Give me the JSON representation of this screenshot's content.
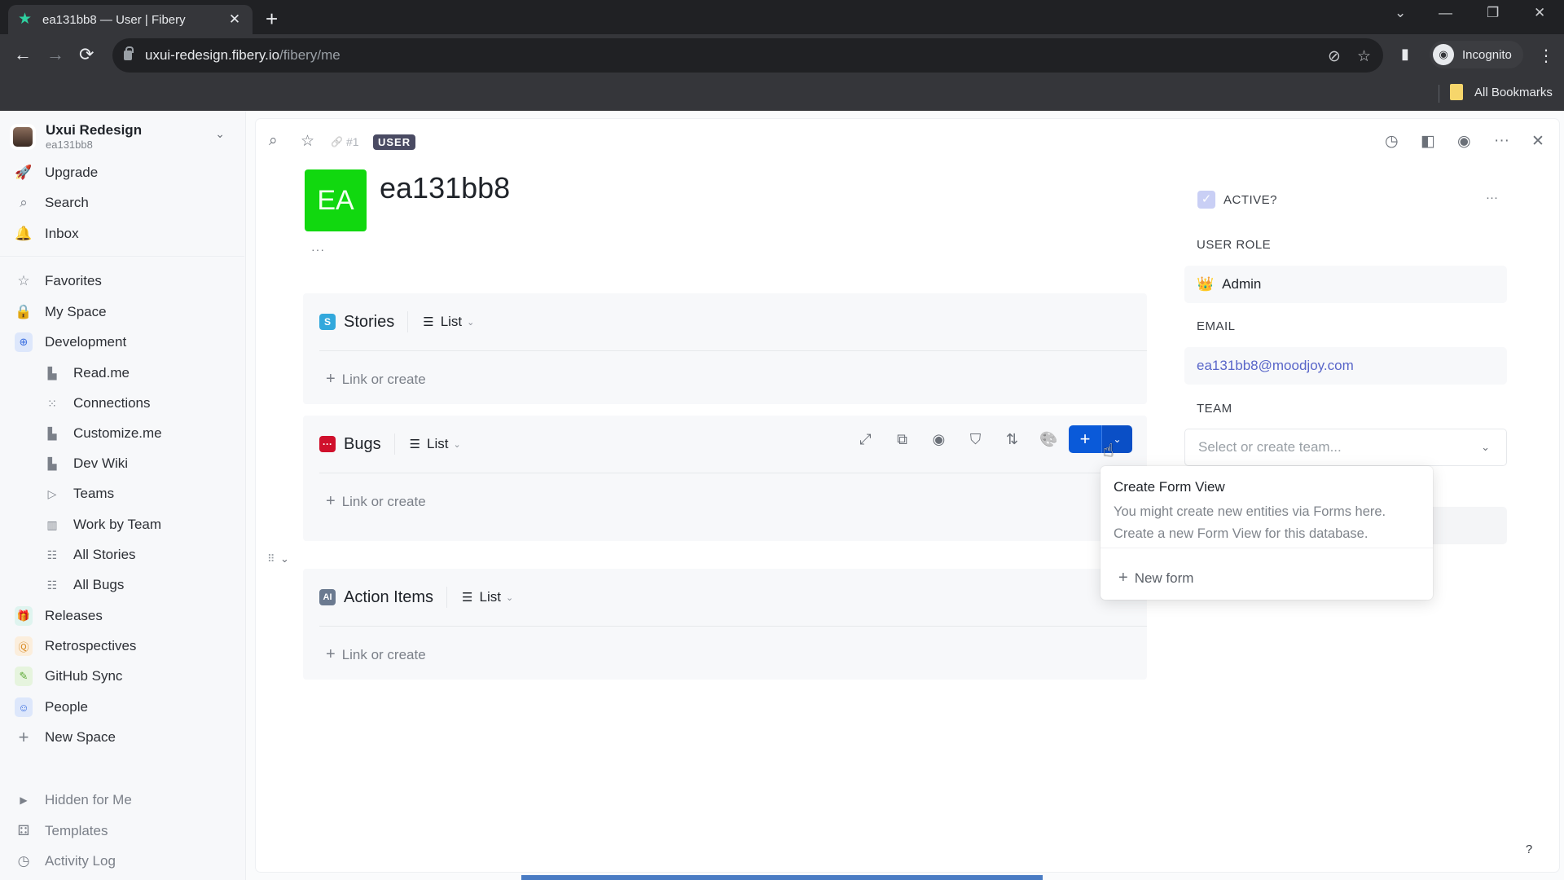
{
  "browser": {
    "tab_title": "ea131bb8 — User | Fibery",
    "url_host": "uxui-redesign.fibery.io",
    "url_path": "/fibery/me",
    "profile_label": "Incognito",
    "bookmarks_label": "All Bookmarks",
    "icons": {
      "favicon": "fibery-star-icon",
      "new_tab": "plus-icon",
      "back": "arrow-left-icon",
      "forward": "arrow-right-icon",
      "reload": "reload-icon",
      "lock": "lock-icon",
      "eye_off": "eye-off-icon",
      "bookmark": "star-icon",
      "side_panel": "side-panel-icon",
      "menu": "kebab-icon"
    },
    "glyphs": {
      "close": "✕",
      "plus": "+",
      "back": "←",
      "forward": "→",
      "reload": "⟳",
      "tab_search": "⌄",
      "minimize": "—",
      "restore": "❐",
      "win_close": "✕",
      "eye_off": "⊘",
      "star": "☆",
      "side_panel": "▮",
      "incognito": "◉",
      "kebab": "⋮"
    }
  },
  "sidebar": {
    "workspace": {
      "name": "Uxui Redesign",
      "user": "ea131bb8",
      "chevron": "⌄"
    },
    "top_items": [
      {
        "label": "Upgrade",
        "icon": "rocket-icon",
        "glyph": "🚀"
      },
      {
        "label": "Search",
        "icon": "search-icon",
        "glyph": "⌕"
      },
      {
        "label": "Inbox",
        "icon": "bell-icon",
        "glyph": "🔔"
      }
    ],
    "items": [
      {
        "label": "Favorites",
        "icon": "star-icon",
        "glyph": "☆"
      },
      {
        "label": "My Space",
        "icon": "lock-icon",
        "glyph": "🔒"
      },
      {
        "label": "Development",
        "icon": "development-space-icon",
        "glyph": "⊕",
        "color": "#3b6fe0",
        "bg": "#dde7fb"
      }
    ],
    "dev_children": [
      {
        "label": "Read.me",
        "icon": "document-icon",
        "glyph": "▙"
      },
      {
        "label": "Connections",
        "icon": "connections-icon",
        "glyph": "⁙"
      },
      {
        "label": "Customize.me",
        "icon": "document-icon",
        "glyph": "▙"
      },
      {
        "label": "Dev Wiki",
        "icon": "document-icon",
        "glyph": "▙"
      },
      {
        "label": "Teams",
        "icon": "database-icon",
        "glyph": "▷"
      },
      {
        "label": "Work by Team",
        "icon": "board-view-icon",
        "glyph": "▥"
      },
      {
        "label": "All Stories",
        "icon": "table-view-icon",
        "glyph": "☷"
      },
      {
        "label": "All Bugs",
        "icon": "table-view-icon",
        "glyph": "☷"
      }
    ],
    "spaces": [
      {
        "label": "Releases",
        "icon": "gift-icon",
        "glyph": "🎁",
        "color": "#26a08a",
        "bg": "#dff4ef"
      },
      {
        "label": "Retrospectives",
        "icon": "retro-icon",
        "glyph": "Ⓠ",
        "color": "#d98a22",
        "bg": "#fbeedd"
      },
      {
        "label": "GitHub Sync",
        "icon": "screw-icon",
        "glyph": "✎",
        "color": "#5aa832",
        "bg": "#e6f4de"
      },
      {
        "label": "People",
        "icon": "people-space-icon",
        "glyph": "☺",
        "color": "#3b6fe0",
        "bg": "#dde7fb"
      },
      {
        "label": "New Space",
        "icon": "plus-icon",
        "glyph": "+"
      }
    ],
    "bottom_items": [
      {
        "label": "Hidden for Me",
        "icon": "triangle-right-icon",
        "glyph": "▶"
      },
      {
        "label": "Templates",
        "icon": "templates-icon",
        "glyph": "⚃"
      },
      {
        "label": "Activity Log",
        "icon": "clock-icon",
        "glyph": "◷"
      }
    ]
  },
  "entity": {
    "id_label": "#1",
    "type_badge": "USER",
    "avatar_initials": "EA",
    "avatar_color": "#11d80f",
    "title": "ea131bb8",
    "more": "···",
    "header_icons": {
      "search": "⌕",
      "favorite": "☆",
      "link": "🔗",
      "history": "◷",
      "layout": "◧",
      "toggle": "◉",
      "more": "···",
      "close": "✕"
    }
  },
  "relations": [
    {
      "name": "Stories",
      "badge": "S",
      "badge_color": "#32a8dc",
      "view": "List",
      "link_create": "Link or create"
    },
    {
      "name": "Bugs",
      "badge": "···",
      "badge_color": "#d0102c",
      "view": "List",
      "link_create": "Link or create"
    },
    {
      "name": "Action Items",
      "badge": "AI",
      "badge_color": "#6b7a90",
      "view": "List",
      "link_create": "Link or create"
    }
  ],
  "bugs_toolbar": {
    "expand": "⤢",
    "relations": "⧉",
    "toggle": "◉",
    "filter": "⛉",
    "sort": "⇅",
    "colors": "🎨",
    "add": "+",
    "add_menu": "⌄"
  },
  "common": {
    "view_icon": "☰",
    "chev": "⌄",
    "plus": "+",
    "drag": "⠿",
    "collapse": "⌄"
  },
  "panel": {
    "active_label": "ACTIVE?",
    "active_checked": true,
    "active_check_glyph": "✓",
    "more": "···",
    "role_label": "USER ROLE",
    "role_icon": "👑",
    "role_value": "Admin",
    "email_label": "EMAIL",
    "email_value": "ea131bb8@moodjoy.com",
    "email_color": "#5966c9",
    "team_label": "TEAM",
    "team_placeholder": "Select or create team..."
  },
  "popover": {
    "title": "Create Form View",
    "description": "You might create new entities via Forms here. Create a new Form View for this database.",
    "new_form": "New form"
  },
  "help": "?"
}
